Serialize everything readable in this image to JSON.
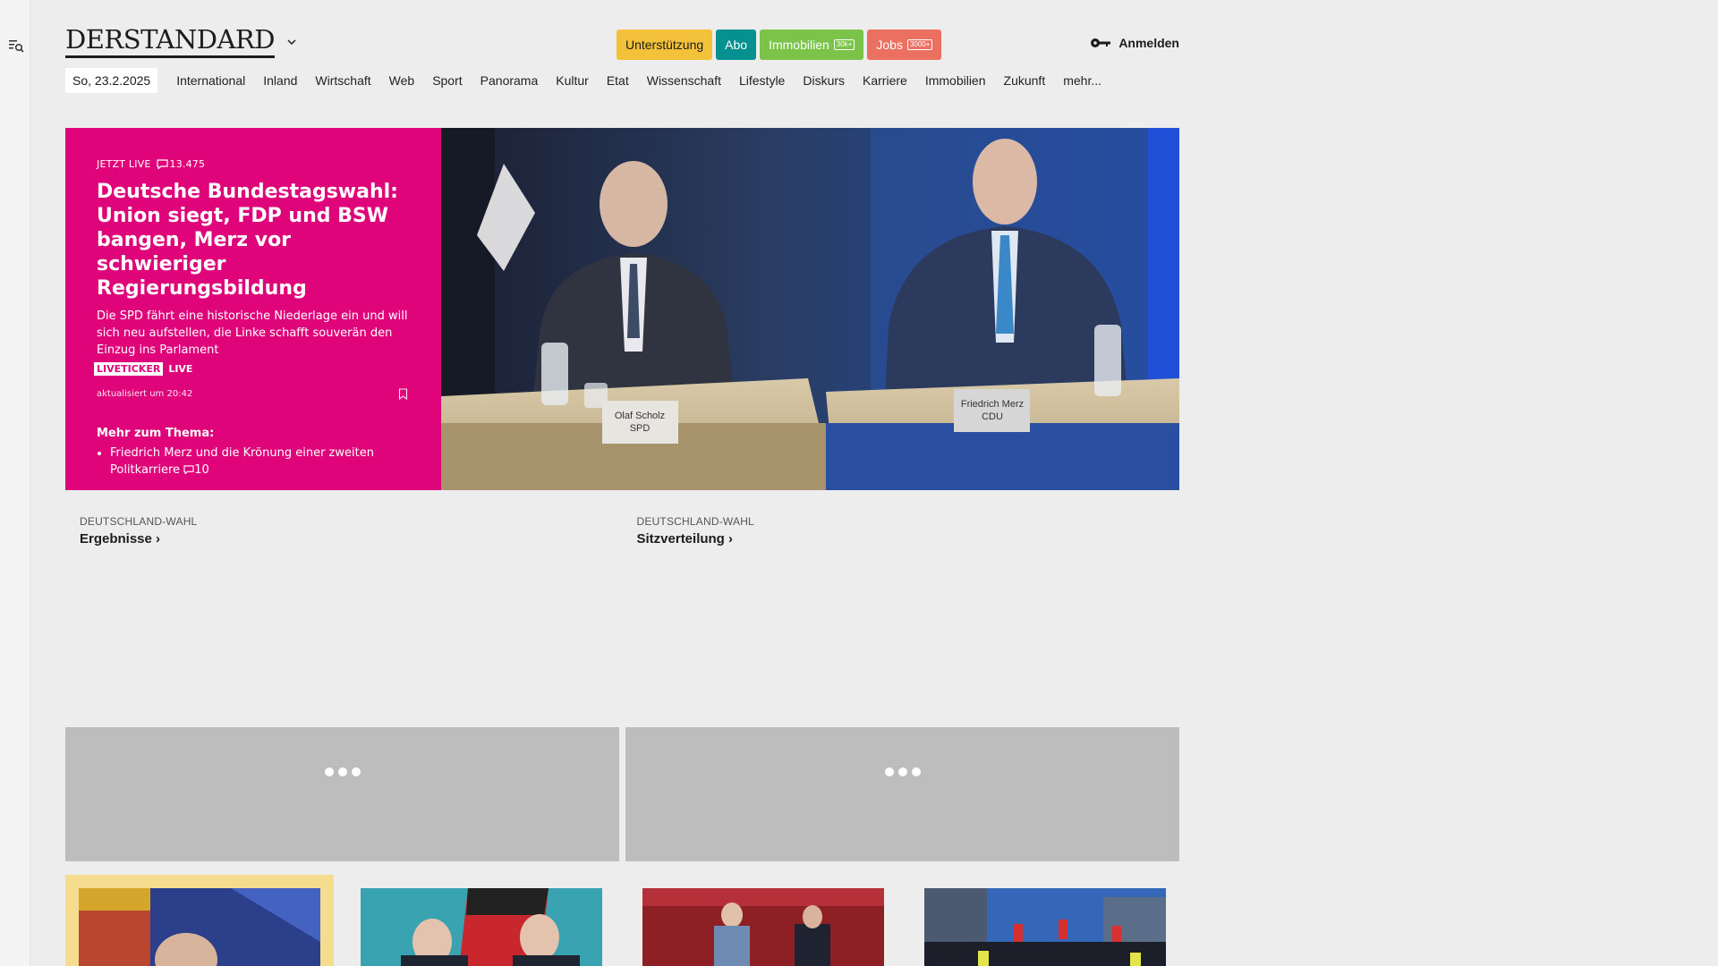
{
  "sidebar": {
    "search_icon": "search-menu-icon"
  },
  "header": {
    "logo": "DERSTANDARD",
    "buttons": {
      "support": "Unterstützung",
      "abo": "Abo",
      "immobilien": "Immobilien",
      "immobilien_badge": "30k+",
      "jobs": "Jobs",
      "jobs_badge": "3000+"
    },
    "login": "Anmelden"
  },
  "nav": {
    "date": "So, 23.2.2025",
    "items": [
      "International",
      "Inland",
      "Wirtschaft",
      "Web",
      "Sport",
      "Panorama",
      "Kultur",
      "Etat",
      "Wissenschaft",
      "Lifestyle",
      "Diskurs",
      "Karriere",
      "Immobilien",
      "Zukunft",
      "mehr..."
    ]
  },
  "hero": {
    "kicker": "JETZT LIVE",
    "comments": "13.475",
    "title": "Deutsche Bundestagswahl: Union siegt, FDP und BSW bangen, Merz vor schwieriger Regierungsbildung",
    "teaser": "Die SPD fährt eine historische Niederlage ein und will sich neu aufstellen, die Linke schafft souverän den Einzug ins Parlament",
    "tag_ticker": "LIVETICKER",
    "tag_live": "LIVE",
    "updated": "aktualisiert um 20:42",
    "more_heading": "Mehr zum Thema:",
    "more_items": [
      {
        "text": "Friedrich Merz und die Krönung einer zweiten Politkarriere",
        "comments": "10"
      }
    ],
    "image_labels": {
      "left": "Olaf Scholz",
      "left_party": "SPD",
      "right": "Friedrich Merz",
      "right_party": "CDU"
    }
  },
  "links": [
    {
      "kicker": "DEUTSCHLAND-WAHL",
      "title": "Ergebnisse ›"
    },
    {
      "kicker": "DEUTSCHLAND-WAHL",
      "title": "Sitzverteilung ›"
    }
  ],
  "colors": {
    "hero_bg": "#e0047a",
    "support": "#f4c23a",
    "abo": "#06908f",
    "immobilien": "#7cc34a",
    "jobs": "#ec7062"
  }
}
